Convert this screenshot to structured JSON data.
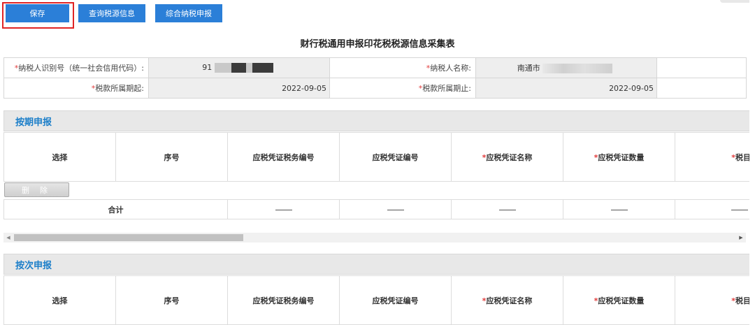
{
  "toolbar": {
    "save": "保存",
    "query": "查询税源信息",
    "comprehensive": "综合纳税申报"
  },
  "page_title": "财行税通用申报印花税税源信息采集表",
  "info": {
    "taxpayer_id_label": "纳税人识别号（统一社会信用代码）:",
    "taxpayer_id_value": "91",
    "taxpayer_name_label": "纳税人名称:",
    "taxpayer_name_value": "南通市",
    "period_start_label": "税款所属期起:",
    "period_start_value": "2022-09-05",
    "period_end_label": "税款所属期止:",
    "period_end_value": "2022-09-05",
    "required_mark": "*"
  },
  "section1": {
    "title": "按期申报"
  },
  "section2": {
    "title": "按次申报"
  },
  "columns": {
    "select": "选择",
    "seq": "序号",
    "tax_voucher_no": "应税凭证税务编号",
    "voucher_no": "应税凭证编号",
    "voucher_name": "应税凭证名称",
    "voucher_qty": "应税凭证数量",
    "tax_item": "税目"
  },
  "delete_button": "删 除",
  "total_label": "合计",
  "icons": {
    "scroll_left": "triangle-left",
    "scroll_right": "triangle-right"
  },
  "colors": {
    "primary": "#2b7fd8",
    "highlight": "#e02424",
    "section_title": "#1b7ec9",
    "required": "#e23b3b"
  }
}
